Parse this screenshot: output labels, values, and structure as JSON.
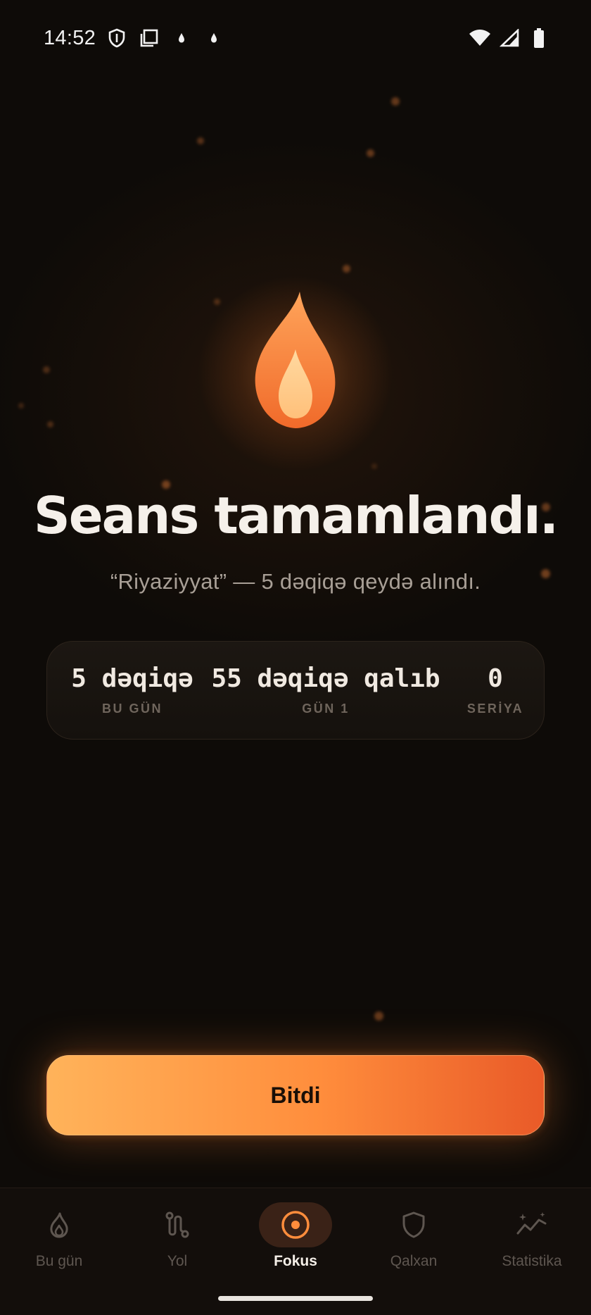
{
  "status_bar": {
    "time": "14:52"
  },
  "completion": {
    "title": "Seans tamamlandı.",
    "subtitle": "“Riyaziyyat” — 5 dəqiqə qeydə alındı."
  },
  "stats": [
    {
      "value": "5 dəqiqə",
      "label": "BU GÜN"
    },
    {
      "value": "55 dəqiqə qalıb",
      "label": "GÜN 1"
    },
    {
      "value": "0",
      "label": "SERİYA"
    }
  ],
  "done_button": {
    "label": "Bitdi"
  },
  "nav": {
    "items": [
      {
        "label": "Bu gün",
        "icon": "flame-icon",
        "active": false
      },
      {
        "label": "Yol",
        "icon": "path-icon",
        "active": false
      },
      {
        "label": "Fokus",
        "icon": "focus-target-icon",
        "active": true
      },
      {
        "label": "Qalxan",
        "icon": "shield-icon",
        "active": false
      },
      {
        "label": "Statistika",
        "icon": "stats-sparkle-icon",
        "active": false
      }
    ]
  },
  "colors": {
    "background": "#0e0b08",
    "accent": "#ff8d3c",
    "accent_light": "#ffb35a",
    "accent_dark": "#e95a28",
    "nav_active_bg": "#3a2217"
  }
}
